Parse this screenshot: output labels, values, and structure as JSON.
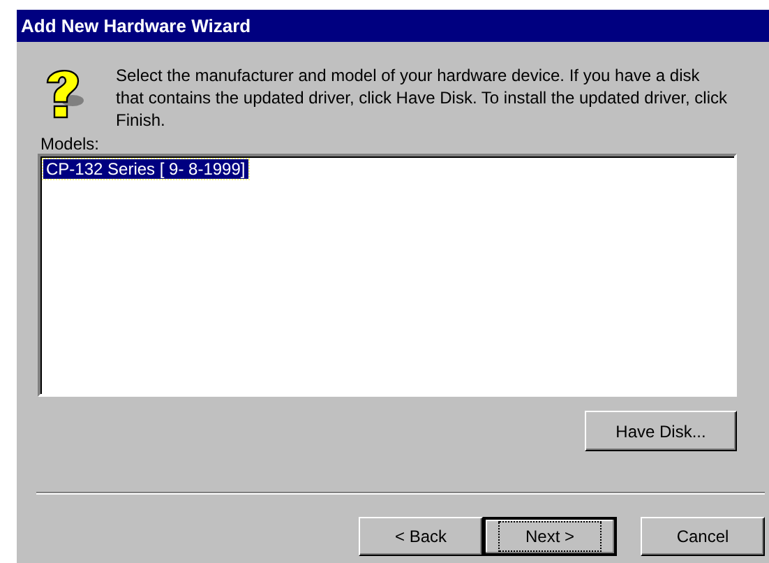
{
  "window": {
    "title": "Add New Hardware Wizard"
  },
  "instructions": "Select the manufacturer and model of your hardware device. If you have a disk that contains the updated driver, click Have Disk. To install the updated driver, click Finish.",
  "models": {
    "label": "Models:",
    "items": [
      {
        "label": "CP-132 Series [ 9- 8-1999]",
        "selected": true
      }
    ]
  },
  "have_disk_button": "Have Disk...",
  "buttons": [
    {
      "label": "< Back",
      "default": false
    },
    {
      "label": "Next >",
      "default": true
    },
    {
      "label": "Cancel",
      "default": false
    }
  ]
}
